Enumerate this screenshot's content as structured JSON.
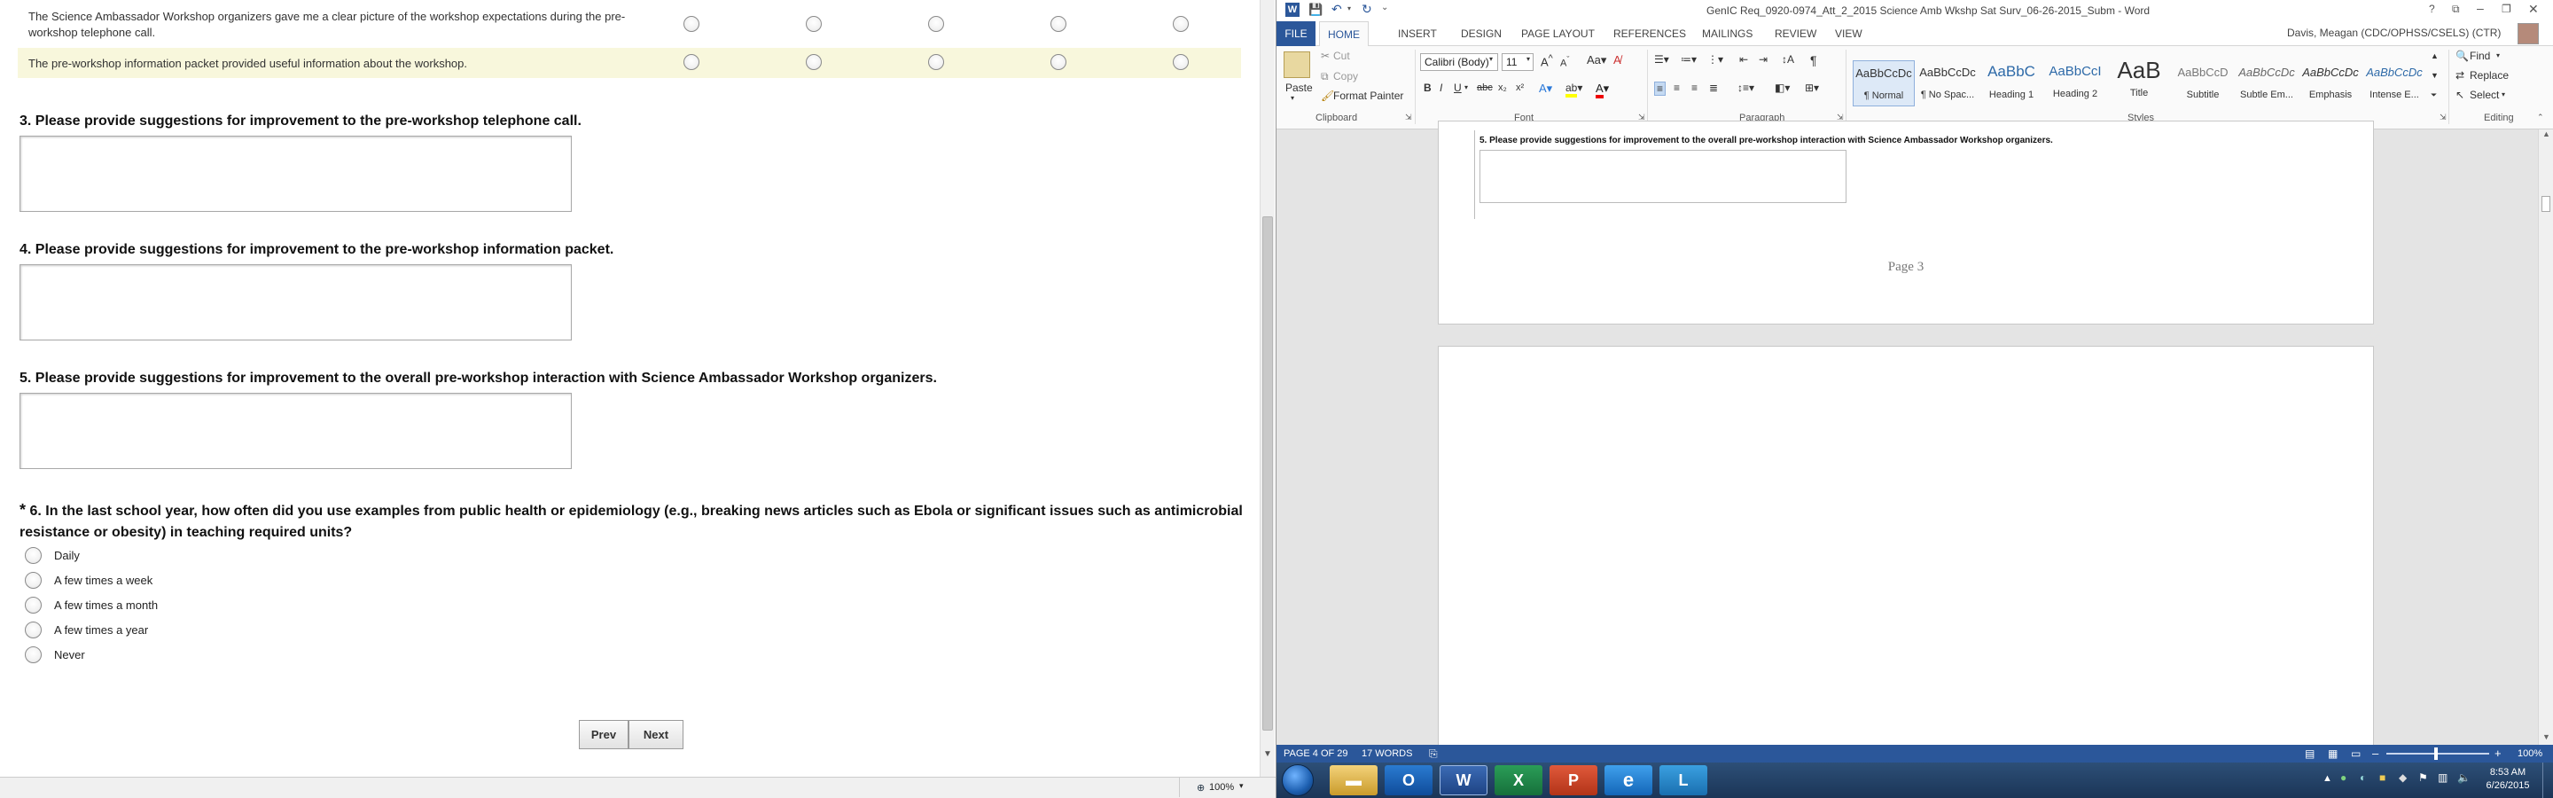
{
  "survey": {
    "matrix_rows": [
      {
        "text": "The Science Ambassador Workshop organizers gave me a clear picture of the workshop expectations during the pre-workshop telephone call."
      },
      {
        "text": "The pre-workshop information packet provided useful information about the workshop."
      }
    ],
    "q3": {
      "title": "3. Please provide suggestions for improvement to the pre-workshop telephone call."
    },
    "q4": {
      "title": "4. Please provide suggestions for improvement to the pre-workshop information packet."
    },
    "q5": {
      "title": "5. Please provide suggestions for improvement to the overall pre-workshop interaction with Science Ambassador Workshop organizers."
    },
    "q6": {
      "required_mark": "*",
      "title": "6. In the last school year, how often did you use examples from public health or epidemiology (e.g., breaking news articles such as Ebola or significant issues such as antimicrobial resistance or obesity) in teaching required units?",
      "options": [
        "Daily",
        "A few times a week",
        "A few times a month",
        "A few times a year",
        "Never"
      ]
    },
    "prev_label": "Prev",
    "next_label": "Next",
    "zoom": "100%"
  },
  "word": {
    "title": "GenIC Req_0920-0974_Att_2_2015 Science Amb Wkshp Sat Surv_06-26-2015_Subm - Word",
    "user": "Davis, Meagan (CDC/OPHSS/CSELS) (CTR)",
    "tabs": [
      "FILE",
      "HOME",
      "INSERT",
      "DESIGN",
      "PAGE LAYOUT",
      "REFERENCES",
      "MAILINGS",
      "REVIEW",
      "VIEW"
    ],
    "clipboard": {
      "paste": "Paste",
      "cut": "Cut",
      "copy": "Copy",
      "format_painter": "Format Painter",
      "label": "Clipboard"
    },
    "font": {
      "name": "Calibri (Body)",
      "size": "11",
      "label": "Font"
    },
    "paragraph_label": "Paragraph",
    "styles": [
      {
        "preview": "AaBbCcDc",
        "name": "¶ Normal"
      },
      {
        "preview": "AaBbCcDc",
        "name": "¶ No Spac..."
      },
      {
        "preview": "AaBbC",
        "name": "Heading 1"
      },
      {
        "preview": "AaBbCcI",
        "name": "Heading 2"
      },
      {
        "preview": "AaB",
        "name": "Title"
      },
      {
        "preview": "AaBbCcD",
        "name": "Subtitle"
      },
      {
        "preview": "AaBbCcDc",
        "name": "Subtle Em..."
      },
      {
        "preview": "AaBbCcDc",
        "name": "Emphasis"
      },
      {
        "preview": "AaBbCcDc",
        "name": "Intense E..."
      }
    ],
    "styles_label": "Styles",
    "editing": {
      "find": "Find",
      "replace": "Replace",
      "select": "Select",
      "label": "Editing"
    },
    "doc_q5": "5. Please provide suggestions for improvement to the overall pre-workshop interaction with Science Ambassador Workshop organizers.",
    "page_label": "Page 3",
    "status_page": "PAGE 4 OF 29",
    "status_words": "17 WORDS",
    "zoom": "100%"
  },
  "taskbar": {
    "time": "8:53 AM",
    "date": "6/26/2015"
  }
}
